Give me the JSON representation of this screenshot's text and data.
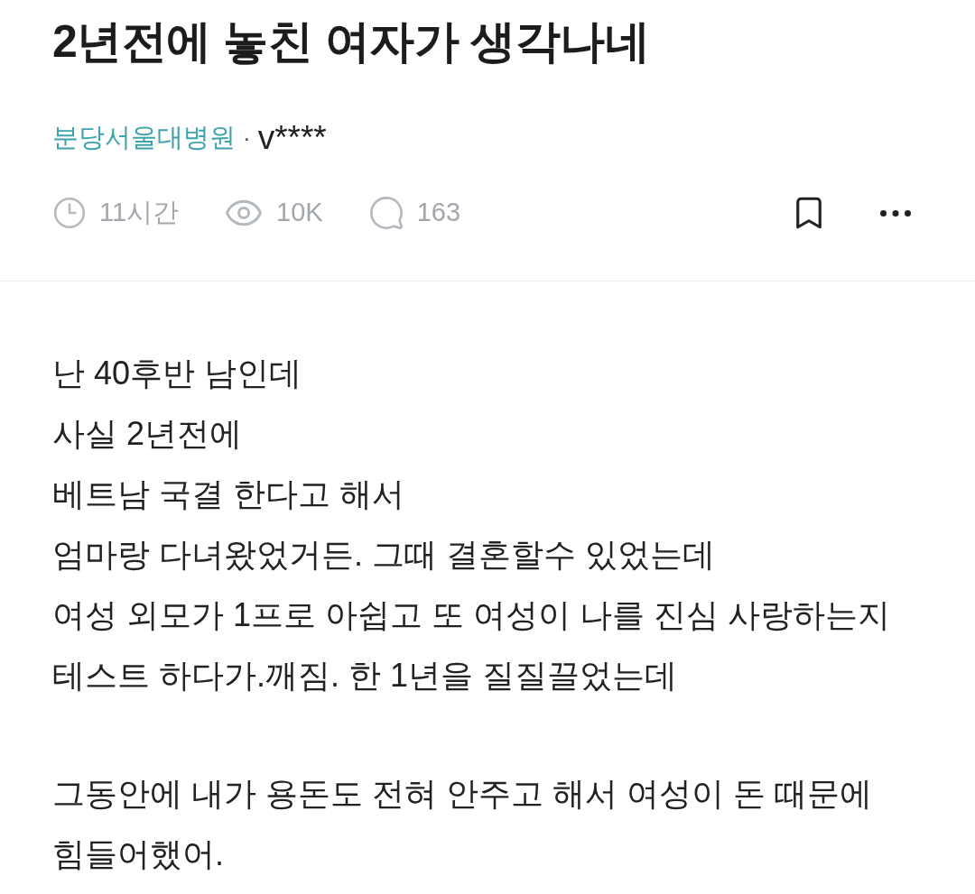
{
  "post": {
    "title": "2년전에 놓친 여자가 생각나네",
    "community": "분당서울대병원",
    "separator": "·",
    "author": "v****"
  },
  "stats": [
    {
      "kind": "time",
      "value": "11시간"
    },
    {
      "kind": "views",
      "value": "10K"
    },
    {
      "kind": "comments",
      "value": "163"
    }
  ],
  "actions": [
    {
      "kind": "bookmark"
    },
    {
      "kind": "more"
    }
  ],
  "body": {
    "paragraphs": [
      {
        "lines": [
          "난 40후반 남인데",
          "사실 2년전에",
          "베트남 국결 한다고 해서",
          "엄마랑 다녀왔었거든. 그때 결혼할수 있었는데",
          "여성 외모가 1프로 아쉽고 또 여성이 나를 진심 사랑하는지",
          "테스트 하다가.깨짐. 한 1년을 질질끌었는데"
        ]
      },
      {
        "lines": [
          "그동안에 내가 용돈도 전혀 안주고 해서 여성이 돈 때문에",
          "힘들어했어."
        ]
      }
    ]
  }
}
